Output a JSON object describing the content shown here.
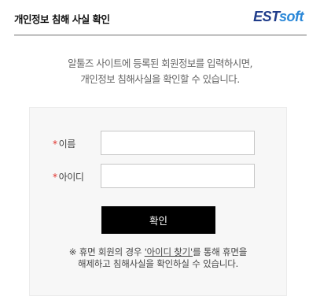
{
  "header": {
    "title": "개인정보 침해 사실 확인",
    "logo_est": "EST",
    "logo_soft": "soft"
  },
  "intro": {
    "line1": "알툴즈 사이트에 등록된 회원정보를 입력하시면,",
    "line2": "개인정보 침해사실을  확인할 수 있습니다."
  },
  "form": {
    "required_mark": "*",
    "name_label": "이름",
    "id_label": "아이디",
    "name_value": "",
    "id_value": "",
    "submit_label": "확인"
  },
  "notice": {
    "prefix": "※ 휴면 회원의 경우 ",
    "link_text": "'아이디 찾기'",
    "suffix": "를 통해 휴면을",
    "line2": "해제하고 침해사실을 확인하실 수 있습니다."
  },
  "colors": {
    "brand_dark": "#1f3c8a",
    "brand_light": "#2b88d8",
    "required": "#e0302a",
    "button": "#000000"
  }
}
